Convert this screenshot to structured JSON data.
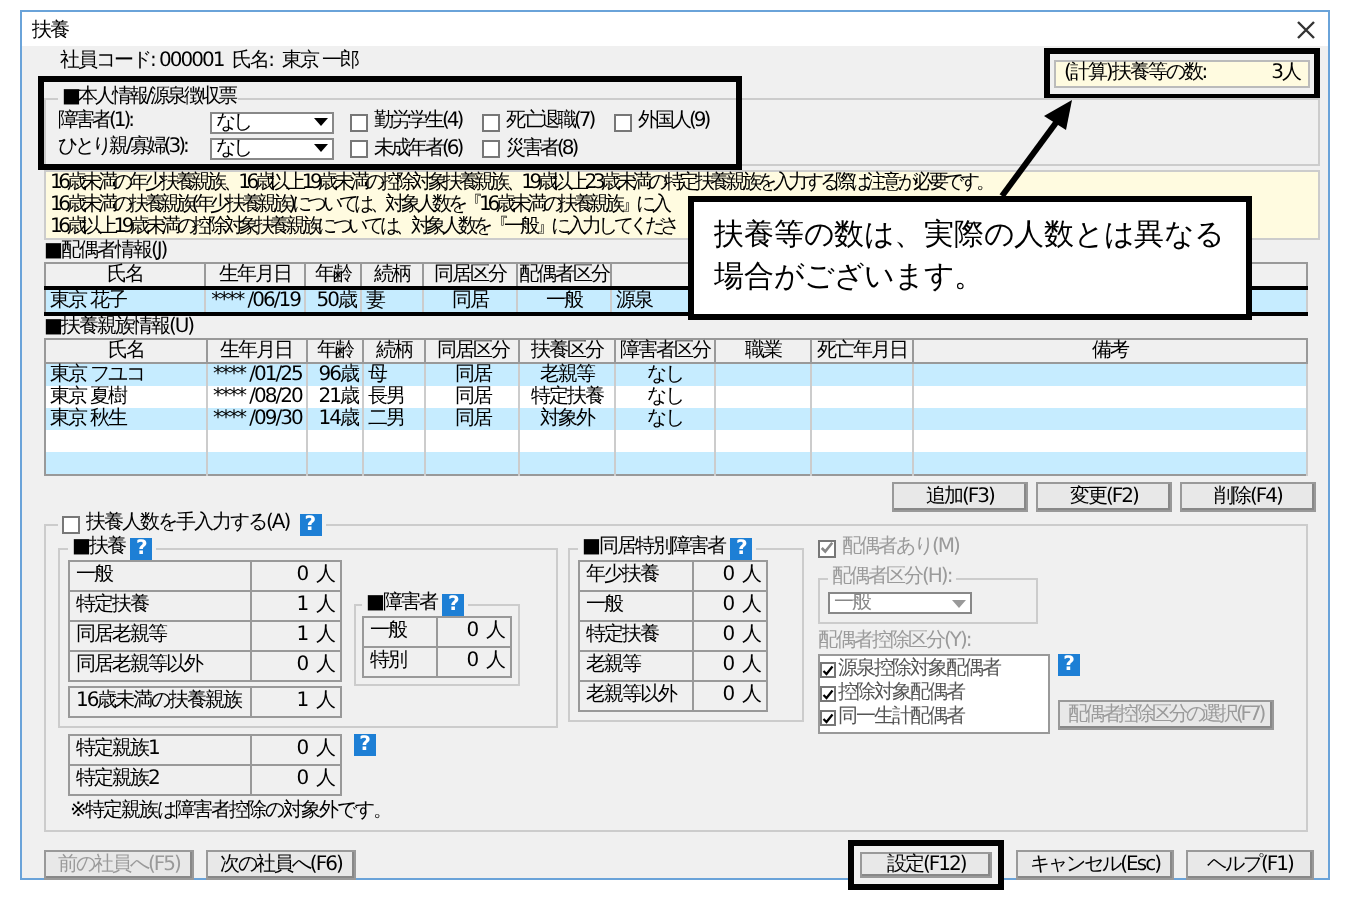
{
  "window": {
    "title": "扶養"
  },
  "employee": {
    "code_label": "社員コード:",
    "code": "000001",
    "name_label": "氏名:",
    "name": "東京 一郎"
  },
  "calc_count": {
    "label": "(計算)扶養等の数:",
    "value": "3人"
  },
  "personal": {
    "title": "■本人情報/源泉徴収票",
    "dropdowns": [
      {
        "label": "障害者(1):",
        "value": "なし"
      },
      {
        "label": "ひとり親/寡婦(3):",
        "value": "なし"
      }
    ],
    "checkboxes": [
      {
        "label": "勤労学生(4)",
        "checked": false
      },
      {
        "label": "死亡退職(7)",
        "checked": false
      },
      {
        "label": "外国人(9)",
        "checked": false
      },
      {
        "label": "未成年者(6)",
        "checked": false
      },
      {
        "label": "災害者(8)",
        "checked": false
      }
    ]
  },
  "notice": [
    "16歳未満の年少扶養親族、16歳以上19歳未満の控除対象扶養親族、19歳以上23歳未満の特定扶養親族を入力する際は注意が必要です。",
    "16歳未満の扶養親族(年少扶養親族)については、対象人数を『16歳未満の扶養親族』に入",
    "16歳以上19歳未満の控除対象扶養親族については、対象人数を『一般』に入力してくださ"
  ],
  "spouse": {
    "title": "■配偶者情報(J)",
    "columns": [
      "氏名",
      "生年月日",
      "年齢",
      "続柄",
      "同居区分",
      "配偶者区分"
    ],
    "rows": [
      {
        "cells": [
          "東京 花子",
          "**** /06/19",
          "50歳",
          "妻",
          "同居",
          "一般",
          "源泉"
        ],
        "selected": true
      }
    ]
  },
  "dependents": {
    "title": "■扶養親族情報(U)",
    "columns": [
      "氏名",
      "生年月日",
      "年齢",
      "続柄",
      "同居区分",
      "扶養区分",
      "障害者区分",
      "職業",
      "死亡年月日",
      "備考"
    ],
    "rows": [
      {
        "cells": [
          "東京 フユコ",
          "**** /01/25",
          "96歳",
          "母",
          "同居",
          "老親等",
          "なし"
        ]
      },
      {
        "cells": [
          "東京 夏樹",
          "**** /08/20",
          "21歳",
          "長男",
          "同居",
          "特定扶養",
          "なし"
        ]
      },
      {
        "cells": [
          "東京 秋生",
          "**** /09/30",
          "14歳",
          "二男",
          "同居",
          "対象外",
          "なし"
        ]
      }
    ]
  },
  "action_buttons": [
    "追加(F3)",
    "変更(F2)",
    "削除(F4)"
  ],
  "manual": {
    "label": "扶養人数を手入力する(A)",
    "checked": false,
    "help": "?"
  },
  "fuyou": {
    "title": "■扶養",
    "help": "?",
    "rows": [
      {
        "label": "一般",
        "value": "0",
        "unit": "人"
      },
      {
        "label": "特定扶養",
        "value": "1",
        "unit": "人"
      },
      {
        "label": "同居老親等",
        "value": "1",
        "unit": "人"
      },
      {
        "label": "同居老親等以外",
        "value": "0",
        "unit": "人"
      }
    ],
    "under16": {
      "label": "16歳未満の扶養親族",
      "value": "1",
      "unit": "人"
    }
  },
  "disabled_group": {
    "title": "■障害者",
    "help": "?",
    "rows": [
      {
        "label": "一般",
        "value": "0",
        "unit": "人"
      },
      {
        "label": "特別",
        "value": "0",
        "unit": "人"
      }
    ]
  },
  "specific": {
    "help": "?",
    "rows": [
      {
        "label": "特定親族1",
        "value": "0",
        "unit": "人"
      },
      {
        "label": "特定親族2",
        "value": "0",
        "unit": "人"
      }
    ],
    "note": "※特定親族は障害者控除の対象外です。"
  },
  "cohabiting": {
    "title": "■同居特別障害者",
    "help": "?",
    "rows": [
      {
        "label": "年少扶養",
        "value": "0",
        "unit": "人"
      },
      {
        "label": "一般",
        "value": "0",
        "unit": "人"
      },
      {
        "label": "特定扶養",
        "value": "0",
        "unit": "人"
      },
      {
        "label": "老親等",
        "value": "0",
        "unit": "人"
      },
      {
        "label": "老親等以外",
        "value": "0",
        "unit": "人"
      }
    ]
  },
  "spouse_panel": {
    "disabled": true,
    "has_spouse": {
      "label": "配偶者あり(M)",
      "checked": true
    },
    "category": {
      "label": "配偶者区分(H):",
      "value": "一般"
    },
    "deduction": {
      "label": "配偶者控除区分(Y):",
      "help": "?",
      "items": [
        {
          "label": "源泉控除対象配偶者",
          "checked": true
        },
        {
          "label": "控除対象配偶者",
          "checked": true
        },
        {
          "label": "同一生計配偶者",
          "checked": true
        }
      ],
      "button": "配偶者控除区分の選択(F7)"
    }
  },
  "footer_buttons": [
    {
      "label": "前の社員へ(F5)",
      "disabled": true,
      "highlighted": false
    },
    {
      "label": "次の社員へ(F6)",
      "disabled": false,
      "highlighted": false
    },
    {
      "label": "設定(F12)",
      "disabled": false,
      "highlighted": true
    },
    {
      "label": "キャンセル(Esc)",
      "disabled": false,
      "highlighted": false
    },
    {
      "label": "ヘルプ(F1)",
      "disabled": false,
      "highlighted": false
    }
  ],
  "callout": {
    "text": "扶養等の数は、実際の人数とは異なる場合がございます。"
  }
}
